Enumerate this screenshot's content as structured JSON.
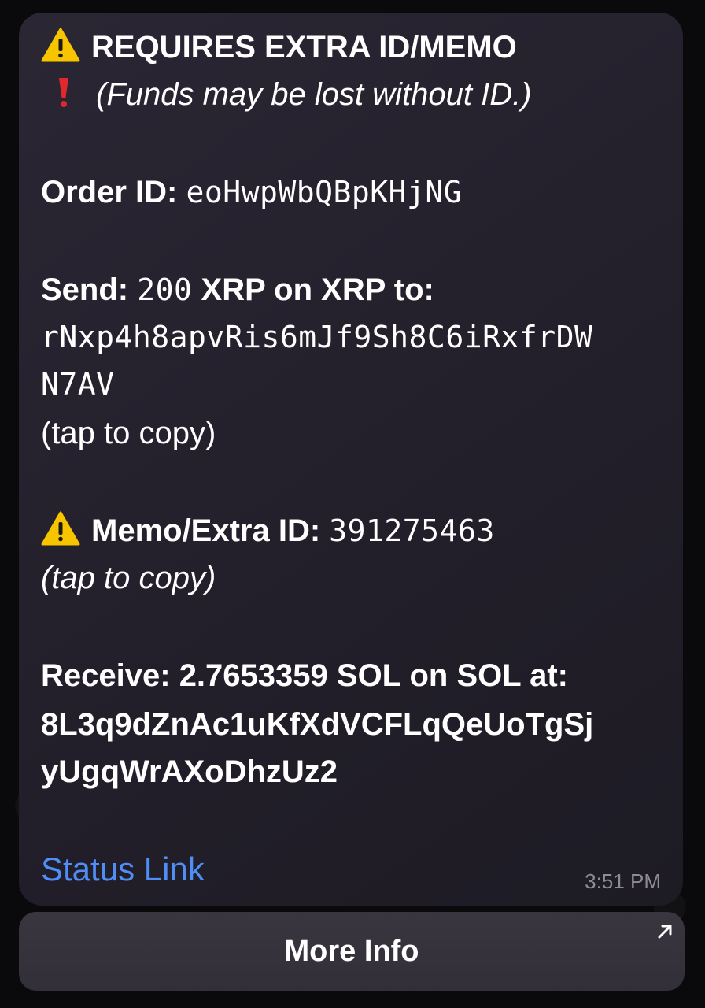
{
  "message": {
    "warning_title": "REQUIRES EXTRA ID/MEMO",
    "warning_note": "(Funds may be lost without ID.)",
    "order_label": "Order ID:",
    "order_id": "eoHwpWbQBpKHjNG",
    "send_label": "Send:",
    "send_amount": "200",
    "send_rest": "XRP on XRP to:",
    "send_address_line1": "rNxp4h8apvRis6mJf9Sh8C6iRxfrDW",
    "send_address_line2": "N7AV",
    "tap_copy_send": "(tap to copy)",
    "memo_label": "Memo/Extra ID:",
    "memo_value": "391275463",
    "tap_copy_memo": "(tap to copy)",
    "receive_label": "Receive:",
    "receive_rest": "2.7653359 SOL on SOL at:",
    "receive_address_line1": "8L3q9dZnAc1uKfXdVCFLqQeUoTgSj",
    "receive_address_line2": "yUgqWrAXoDhzUz2",
    "status_link": "Status Link",
    "time": "3:51 PM"
  },
  "button": {
    "more_info": "More Info"
  },
  "icons": {
    "warning": "warning-icon",
    "exclamation": "exclamation-icon",
    "external_arrow": "external-link-icon"
  },
  "colors": {
    "link": "#4f8ef7",
    "warning_yellow": "#f7c400",
    "exclamation_red": "#e0282e",
    "bubble": "#26222d",
    "timestamp": "#8e8a96"
  }
}
